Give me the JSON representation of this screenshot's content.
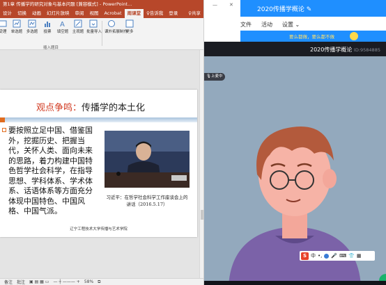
{
  "ppt": {
    "window_title": "第1章 传播学的研究对象与基本问题 [兼容模式] - PowerPoint...",
    "tabs": [
      "设计",
      "切换",
      "动画",
      "幻灯片放映",
      "审阅",
      "视图",
      "Acrobat",
      "雨课堂",
      "♀告诉我",
      "登录",
      "♀共享"
    ],
    "active_tab_index": 7,
    "ribbon_buttons": [
      "受理",
      "单选题",
      "多选题",
      "投票",
      "填空题",
      "主观题",
      "批量导入",
      "课外拓展制作",
      "更多"
    ],
    "ribbon_group_label": "插入题目",
    "slide": {
      "title_highlight": "观点争鸣：",
      "title_rest": "传播学的本土化",
      "body": "要按照立足中国、借鉴国外，挖掘历史、把握当代，关怀人类、面向未来的思路，着力构建中国特色哲学社会科学，在指导思想、学科体系、学术体系、话语体系等方面充分体现中国特色、中国风格、中国气派。",
      "photo_caption": "习近平：在哲学社会科学工作座谈会上的讲话（2016.5.17）",
      "footer": "辽宁工程技术大学传播与艺术学院"
    },
    "statusbar": {
      "notes": "备注",
      "comments": "批注",
      "zoom": "58%"
    }
  },
  "chat": {
    "title": "2020传播学概论",
    "nav": [
      "文件",
      "活动",
      "设置"
    ],
    "banner": "要么都做，要么都不做"
  },
  "live": {
    "title": "2020传播学概论",
    "id_label": "ID:9584885",
    "mic_label": "上麦中"
  },
  "ime": {
    "lang": "中"
  },
  "colors": {
    "ppt_accent": "#b7472a",
    "chat_blue": "#1f8fff",
    "title_red": "#d23b22",
    "bullet_orange": "#e06c1f"
  }
}
